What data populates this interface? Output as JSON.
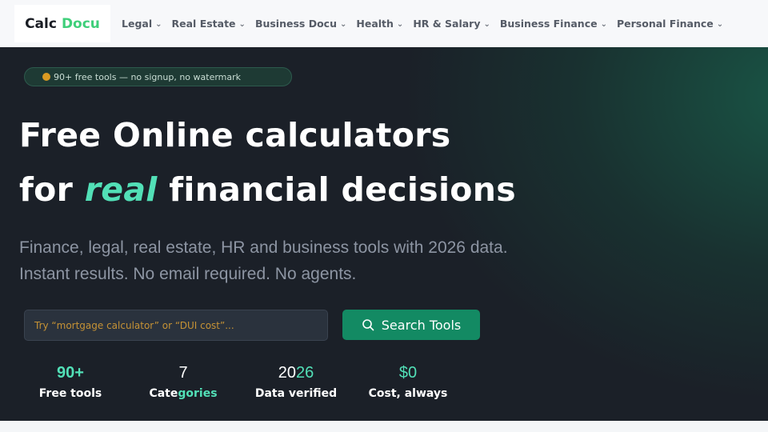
{
  "brand": {
    "part1": "Calc",
    "part2": "Docu",
    "accent_color": "#3fcf7a"
  },
  "nav": {
    "items": [
      {
        "label": "Legal"
      },
      {
        "label": "Real Estate"
      },
      {
        "label": "Business Docu"
      },
      {
        "label": "Health"
      },
      {
        "label": "HR & Salary"
      },
      {
        "label": "Business Finance"
      },
      {
        "label": "Personal Finance"
      }
    ],
    "chevron_icon": "chevron-down-icon"
  },
  "hero": {
    "badge": "90+ free tools — no signup, no watermark",
    "headline_line1": "Free Online calculators",
    "headline_line2_pre": "for",
    "headline_line2_accent": "real",
    "headline_line2_post": "financial decisions",
    "subtitle_line1": "Finance, legal, real estate, HR and business tools with 2026 data.",
    "subtitle_line2": "Instant results. No email required. No agents.",
    "accent_color": "#52e0b7"
  },
  "search": {
    "placeholder": "Try “mortgage calculator” or “DUI cost”...",
    "button_label": "Search Tools",
    "button_icon": "search-icon",
    "button_color": "#138a63"
  },
  "stats": [
    {
      "value": "90+",
      "label": "Free tools"
    },
    {
      "value": "7",
      "label_a": "Cate",
      "label_b": "gories"
    },
    {
      "value_a": "20",
      "value_b": "26",
      "label": "Data verified"
    },
    {
      "value": "$0",
      "label": "Cost, always"
    }
  ]
}
